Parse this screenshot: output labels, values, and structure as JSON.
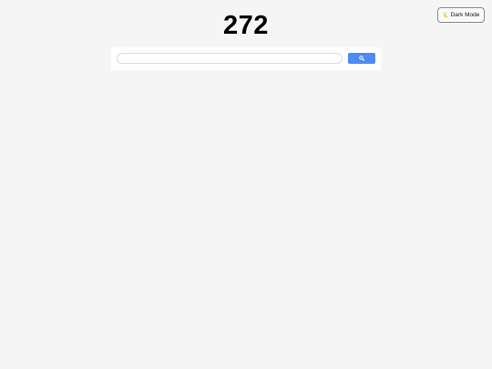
{
  "header": {
    "title": "272"
  },
  "dark_mode_toggle": {
    "label": "Dark Mode",
    "icon": "moon-icon"
  },
  "search": {
    "value": "",
    "placeholder": "",
    "button_icon": "search-icon",
    "button_color": "#4c8bf5"
  },
  "colors": {
    "background": "#f5f5f5",
    "search_box": "#ffffff"
  }
}
